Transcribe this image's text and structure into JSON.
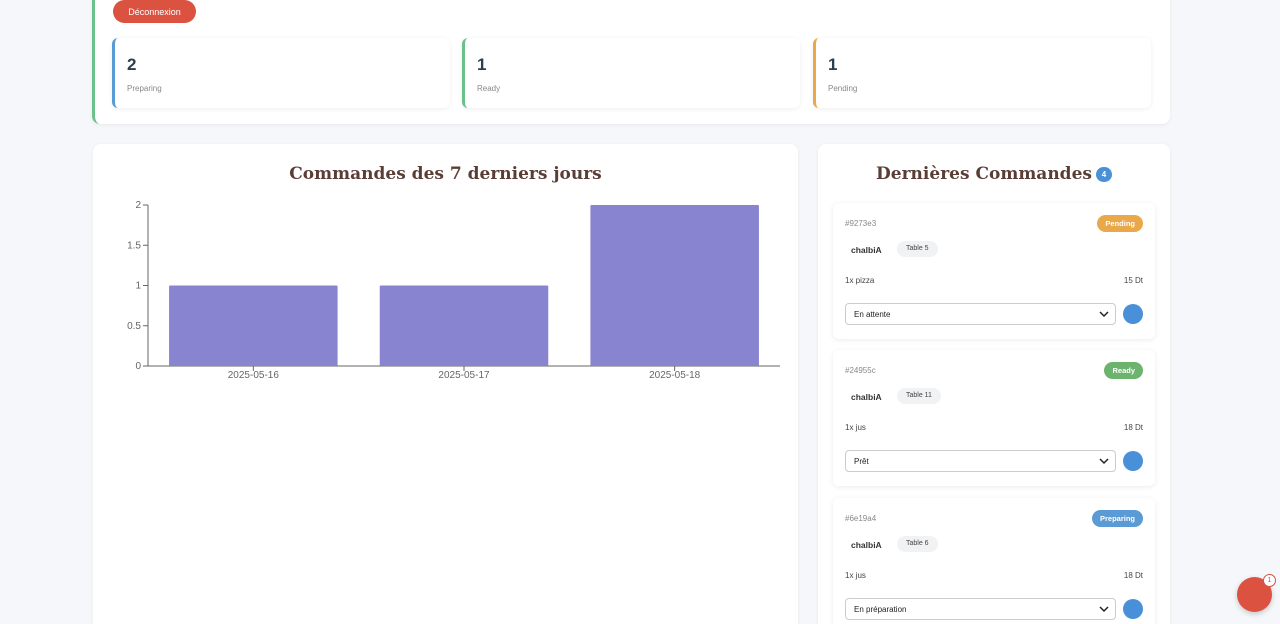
{
  "header": {
    "logout_label": "Déconnexion"
  },
  "stats": [
    {
      "value": "2",
      "label": "Preparing"
    },
    {
      "value": "1",
      "label": "Ready"
    },
    {
      "value": "1",
      "label": "Pending"
    }
  ],
  "chart_data": {
    "type": "bar",
    "title": "Commandes des 7 derniers jours",
    "categories": [
      "2025-05-16",
      "2025-05-17",
      "2025-05-18"
    ],
    "values": [
      1,
      1,
      2
    ],
    "ylim": [
      0,
      2
    ],
    "yticks": [
      "0",
      "0.5",
      "1",
      "1.5",
      "2"
    ],
    "grid": false,
    "bar_color": "#8884d0"
  },
  "orders_panel": {
    "title": "Dernières Commandes",
    "count": "4"
  },
  "orders": [
    {
      "id": "#9273e3",
      "status": "Pending",
      "customer": "chalbiA",
      "table": "Table 5",
      "item": "1x pizza",
      "price": "15 Dt",
      "select_value": "En attente"
    },
    {
      "id": "#24955c",
      "status": "Ready",
      "customer": "chalbiA",
      "table": "Table 11",
      "item": "1x jus",
      "price": "18 Dt",
      "select_value": "Prêt"
    },
    {
      "id": "#6e19a4",
      "status": "Preparing",
      "customer": "chalbiA",
      "table": "Table 6",
      "item": "1x jus",
      "price": "18 Dt",
      "select_value": "En préparation"
    }
  ],
  "notification": {
    "count": "1"
  },
  "colors": {
    "accent_red": "#db5241",
    "preparing": "#5b9bd5",
    "ready": "#6cc08b",
    "pending": "#e9a849",
    "bar": "#8884d0"
  }
}
